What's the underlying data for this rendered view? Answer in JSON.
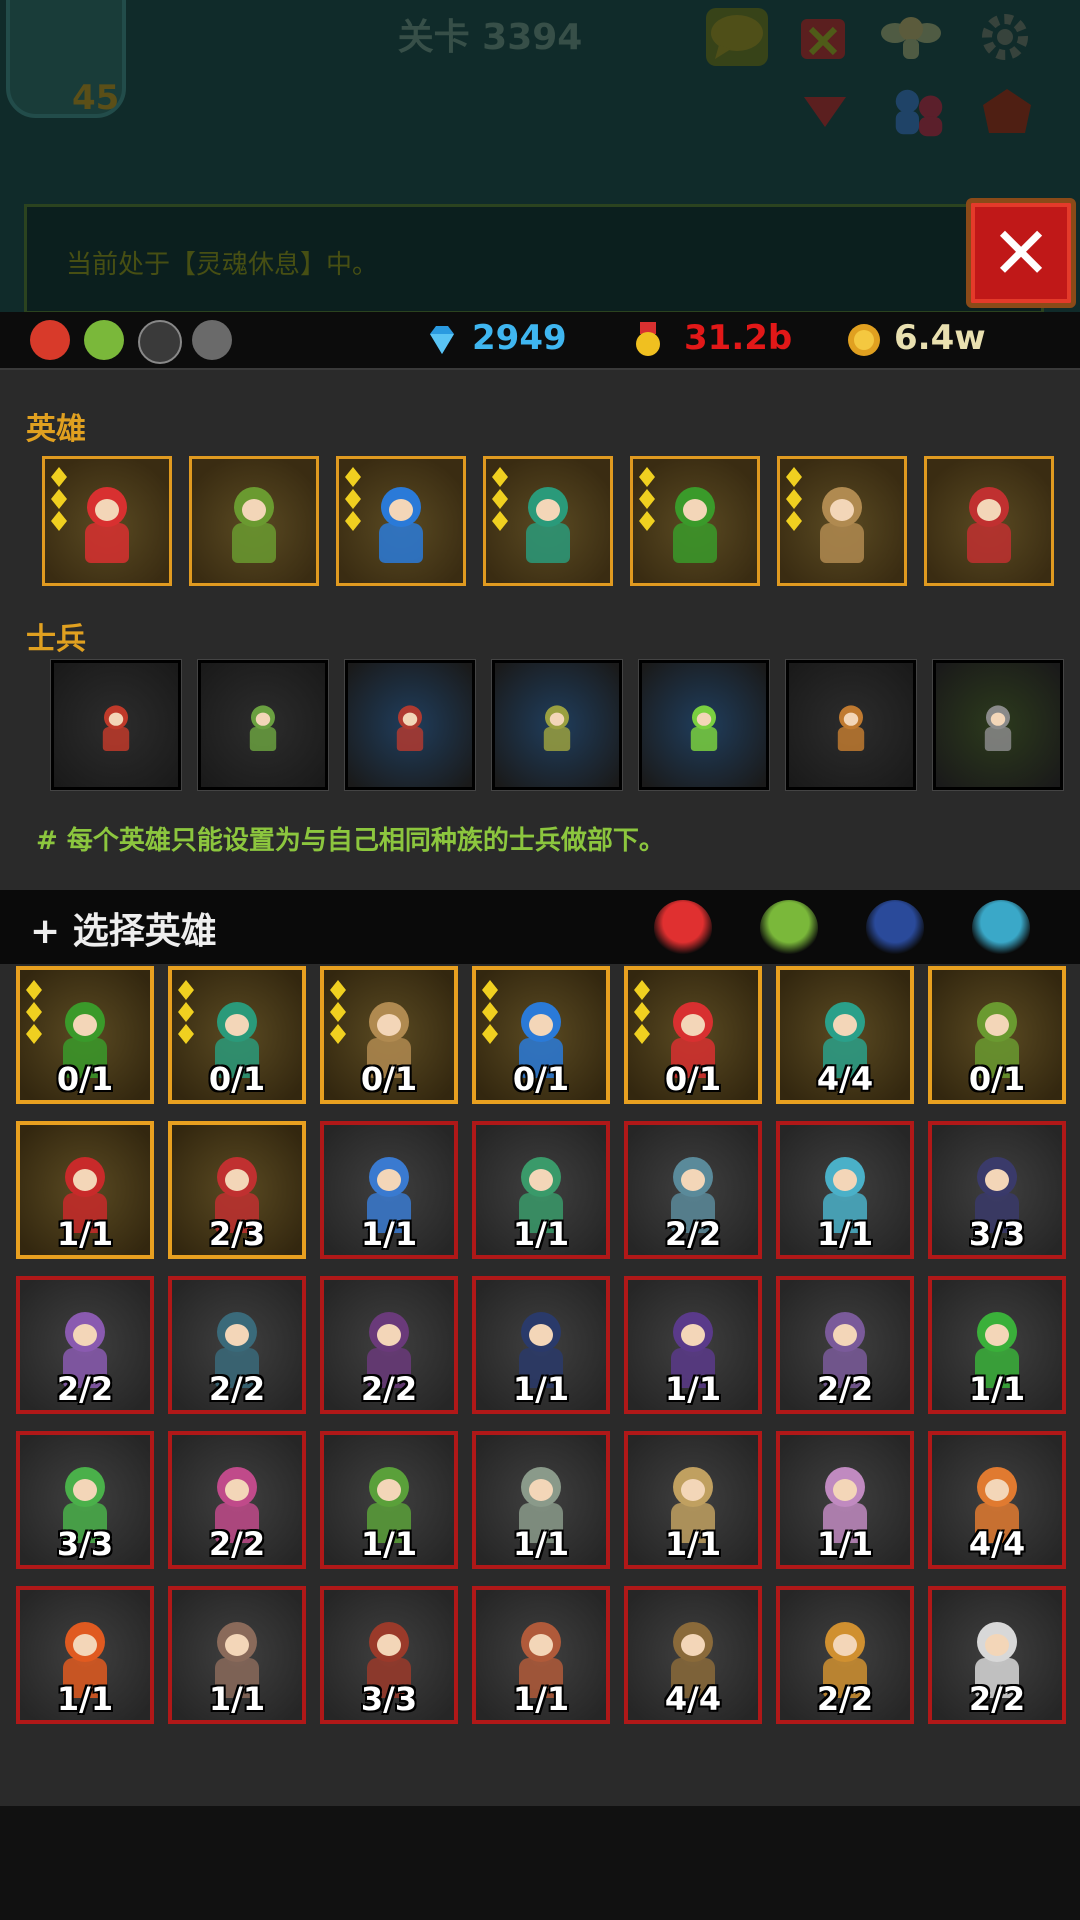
{
  "header": {
    "stage_title": "关卡 3394",
    "player_level": "45",
    "notice": "当前处于【灵魂休息】中。",
    "close_label": "✕"
  },
  "resources": {
    "gems": "2949",
    "medals": "31.2b",
    "gold": "6.4w",
    "gem_color": "#3fb6f0",
    "medal_color": "#e21818",
    "gold_color": "#e9e0b0"
  },
  "party": {
    "heroes_label": "英雄",
    "soldiers_label": "士兵",
    "heroes": [
      {
        "name": "hero-winged-archer",
        "color": "#d83030",
        "stars": 3
      },
      {
        "name": "hero-leaf-fox",
        "color": "#6a9a30",
        "stars": 0
      },
      {
        "name": "hero-blue-knight",
        "color": "#2a7ad8",
        "stars": 3
      },
      {
        "name": "hero-green-griffin",
        "color": "#2a9a7a",
        "stars": 3
      },
      {
        "name": "hero-green-mage",
        "color": "#3a9a2a",
        "stars": 3
      },
      {
        "name": "hero-fox-priestess",
        "color": "#b08a50",
        "stars": 3
      },
      {
        "name": "hero-red-healer",
        "color": "#c03030",
        "stars": 0
      }
    ],
    "soldiers": [
      {
        "name": "soldier-human",
        "color": "#c03a2a",
        "bg": "#2c2c2c"
      },
      {
        "name": "soldier-elf",
        "color": "#6aa040",
        "bg": "#2c2c2c"
      },
      {
        "name": "soldier-axe",
        "color": "#b03a30",
        "bg": "#1f3d5c"
      },
      {
        "name": "soldier-archer",
        "color": "#9aa040",
        "bg": "#1f3d5c"
      },
      {
        "name": "soldier-bird",
        "color": "#7ad040",
        "bg": "#1f3d5c"
      },
      {
        "name": "soldier-monkey",
        "color": "#c07a30",
        "bg": "#2c2c2c"
      },
      {
        "name": "soldier-dark",
        "color": "#8a8a8a",
        "bg": "#2c3a1c"
      }
    ],
    "tip": "# 每个英雄只能设置为与自己相同种族的士兵做部下。"
  },
  "selector": {
    "title": "+ 选择英雄",
    "filters": [
      {
        "name": "filter-human-icon",
        "color": "#e03030"
      },
      {
        "name": "filter-elf-icon",
        "color": "#7ab83a"
      },
      {
        "name": "filter-undead-icon",
        "color": "#2a4a9a"
      },
      {
        "name": "filter-monster-icon",
        "color": "#3aa8c8"
      }
    ],
    "rows": [
      [
        {
          "count": "0/1",
          "type": "gold",
          "color": "#3a9a2a",
          "stars": 3
        },
        {
          "count": "0/1",
          "type": "gold",
          "color": "#2a9a7a",
          "stars": 3
        },
        {
          "count": "0/1",
          "type": "gold",
          "color": "#b08a50",
          "stars": 3
        },
        {
          "count": "0/1",
          "type": "gold",
          "color": "#2a7ad8",
          "stars": 3
        },
        {
          "count": "0/1",
          "type": "gold",
          "color": "#d83030",
          "stars": 3
        },
        {
          "count": "4/4",
          "type": "gold",
          "color": "#2aa08a",
          "stars": 0
        },
        {
          "count": "0/1",
          "type": "gold",
          "color": "#6a9a30",
          "stars": 0
        }
      ],
      [
        {
          "count": "1/1",
          "type": "gold",
          "color": "#c82a2a",
          "stars": 0
        },
        {
          "count": "2/3",
          "type": "gold",
          "color": "#c03030",
          "stars": 0
        },
        {
          "count": "1/1",
          "type": "red",
          "color": "#3a7ad0",
          "stars": 0
        },
        {
          "count": "1/1",
          "type": "red",
          "color": "#3a9a6a",
          "stars": 0
        },
        {
          "count": "2/2",
          "type": "red",
          "color": "#5a8a9a",
          "stars": 0
        },
        {
          "count": "1/1",
          "type": "red",
          "color": "#4ab0c8",
          "stars": 0
        },
        {
          "count": "3/3",
          "type": "red",
          "color": "#3a3a6a",
          "stars": 0
        }
      ],
      [
        {
          "count": "2/2",
          "type": "red",
          "color": "#8a5ab0",
          "stars": 0
        },
        {
          "count": "2/2",
          "type": "red",
          "color": "#3a6a7a",
          "stars": 0
        },
        {
          "count": "2/2",
          "type": "red",
          "color": "#6a3a7a",
          "stars": 0
        },
        {
          "count": "1/1",
          "type": "red",
          "color": "#2a3a6a",
          "stars": 0
        },
        {
          "count": "1/1",
          "type": "red",
          "color": "#5a3a8a",
          "stars": 0
        },
        {
          "count": "2/2",
          "type": "red",
          "color": "#7a5a9a",
          "stars": 0
        },
        {
          "count": "1/1",
          "type": "red",
          "color": "#3ab03a",
          "stars": 0
        }
      ],
      [
        {
          "count": "3/3",
          "type": "red",
          "color": "#4ab04a",
          "stars": 0
        },
        {
          "count": "2/2",
          "type": "red",
          "color": "#c04a8a",
          "stars": 0
        },
        {
          "count": "1/1",
          "type": "red",
          "color": "#5aa03a",
          "stars": 0
        },
        {
          "count": "1/1",
          "type": "red",
          "color": "#8a9a8a",
          "stars": 0
        },
        {
          "count": "1/1",
          "type": "red",
          "color": "#c0a060",
          "stars": 0
        },
        {
          "count": "1/1",
          "type": "red",
          "color": "#c08ac0",
          "stars": 0
        },
        {
          "count": "4/4",
          "type": "red",
          "color": "#e07a30",
          "stars": 0
        }
      ],
      [
        {
          "count": "1/1",
          "type": "red",
          "color": "#e05a20",
          "stars": 0
        },
        {
          "count": "1/1",
          "type": "red",
          "color": "#8a6a5a",
          "stars": 0
        },
        {
          "count": "3/3",
          "type": "red",
          "color": "#9a3a2a",
          "stars": 0
        },
        {
          "count": "1/1",
          "type": "red",
          "color": "#b05a3a",
          "stars": 0
        },
        {
          "count": "4/4",
          "type": "red",
          "color": "#8a6a3a",
          "stars": 0
        },
        {
          "count": "2/2",
          "type": "red",
          "color": "#d09030",
          "stars": 0
        },
        {
          "count": "2/2",
          "type": "red",
          "color": "#d8d8d8",
          "stars": 0
        }
      ]
    ]
  }
}
